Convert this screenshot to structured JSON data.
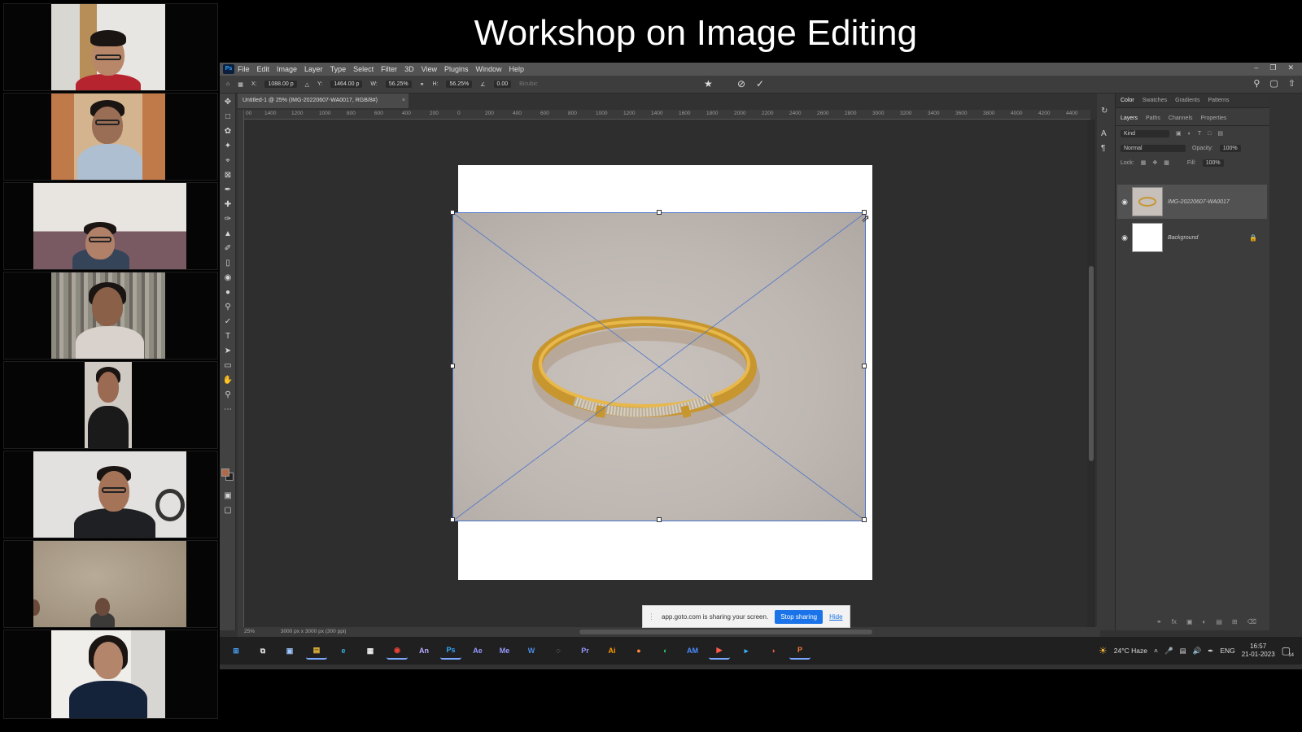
{
  "meeting": {
    "title": "Workshop on Image Editing",
    "participants": [
      {
        "label": "participant-1"
      },
      {
        "label": "participant-2"
      },
      {
        "label": "participant-3"
      },
      {
        "label": "participant-4"
      },
      {
        "label": "participant-5"
      },
      {
        "label": "participant-6"
      },
      {
        "label": "participant-7"
      },
      {
        "label": "participant-8"
      }
    ]
  },
  "photoshop": {
    "menu": [
      "File",
      "Edit",
      "Image",
      "Layer",
      "Type",
      "Select",
      "Filter",
      "3D",
      "View",
      "Plugins",
      "Window",
      "Help"
    ],
    "options": {
      "x": "1088.00 p",
      "y": "1464.00 p",
      "w": "56.25%",
      "h": "56.25%",
      "angle": "0.00",
      "interpolation": "Bicubic"
    },
    "document_tab": "Untitled-1 @ 25% (IMG-20220607-WA0017, RGB/8#)",
    "ruler_ticks": [
      "00",
      "1400",
      "1200",
      "1000",
      "800",
      "600",
      "400",
      "200",
      "0",
      "200",
      "400",
      "600",
      "800",
      "1000",
      "1200",
      "1400",
      "1600",
      "1800",
      "2000",
      "2200",
      "2400",
      "2600",
      "2800",
      "3000",
      "3200",
      "3400",
      "3600",
      "3800",
      "4000",
      "4200",
      "4400"
    ],
    "panels": {
      "top_tabs": [
        "Color",
        "Swatches",
        "Gradients",
        "Patterns"
      ],
      "layer_tabs": [
        "Layers",
        "Paths",
        "Channels",
        "Properties"
      ],
      "kind_label": "Kind",
      "blend_mode": "Normal",
      "opacity_label": "Opacity:",
      "opacity_value": "100%",
      "lock_label": "Lock:",
      "fill_label": "Fill:",
      "fill_value": "100%",
      "layers": [
        {
          "name": "IMG-20220607-WA0017",
          "selected": true
        },
        {
          "name": "Background",
          "selected": false,
          "locked": true
        }
      ]
    },
    "status": {
      "zoom": "25%",
      "doc_info": "3000 px x 3000 px (300 ppi)"
    },
    "share_bar": {
      "text": "app.goto.com is sharing your screen.",
      "stop": "Stop sharing",
      "hide": "Hide"
    }
  },
  "taskbar": {
    "apps": [
      {
        "name": "start-icon",
        "label": "⊞",
        "color": "#4aa3ff",
        "active": false
      },
      {
        "name": "task-view-icon",
        "label": "⧉",
        "color": "#ddd",
        "active": false
      },
      {
        "name": "camera-icon",
        "label": "▣",
        "color": "#9fc6ff",
        "active": false
      },
      {
        "name": "explorer-icon",
        "label": "▤",
        "color": "#f5c33b",
        "active": true
      },
      {
        "name": "edge-icon",
        "label": "e",
        "color": "#33b3e6",
        "active": false
      },
      {
        "name": "store-icon",
        "label": "▦",
        "color": "#f0f0f0",
        "active": false
      },
      {
        "name": "chrome-icon",
        "label": "◉",
        "color": "#e94335",
        "active": true
      },
      {
        "name": "animate-icon",
        "label": "An",
        "color": "#b9a9ff",
        "active": false
      },
      {
        "name": "photoshop-icon",
        "label": "Ps",
        "color": "#31a8ff",
        "active": true
      },
      {
        "name": "after-effects-icon",
        "label": "Ae",
        "color": "#9999ff",
        "active": false
      },
      {
        "name": "media-encoder-icon",
        "label": "Me",
        "color": "#9999ff",
        "active": false
      },
      {
        "name": "word-icon",
        "label": "W",
        "color": "#4c8ee6",
        "active": false
      },
      {
        "name": "obs-icon",
        "label": "◌",
        "color": "#cfcfcf",
        "active": false
      },
      {
        "name": "premiere-icon",
        "label": "Pr",
        "color": "#9999ff",
        "active": false
      },
      {
        "name": "illustrator-icon",
        "label": "Ai",
        "color": "#ff9a00",
        "active": false
      },
      {
        "name": "paint-icon",
        "label": "●",
        "color": "#ff8a3d",
        "active": false
      },
      {
        "name": "whatsapp-icon",
        "label": "◐",
        "color": "#25d366",
        "active": false
      },
      {
        "name": "app-am-icon",
        "label": "AM",
        "color": "#4a8cff",
        "active": false
      },
      {
        "name": "recorder-icon",
        "label": "▶",
        "color": "#ff5a4a",
        "active": true
      },
      {
        "name": "goto-icon",
        "label": "▸",
        "color": "#38b6ff",
        "active": false
      },
      {
        "name": "powerpoint-icon",
        "label": "◑",
        "color": "#e5603a",
        "active": false
      },
      {
        "name": "impress-icon",
        "label": "P",
        "color": "#f07a3a",
        "active": true
      }
    ],
    "weather": "24°C Haze",
    "language": "ENG",
    "time": "16:57",
    "date": "21-01-2023",
    "notification_count": "14"
  }
}
